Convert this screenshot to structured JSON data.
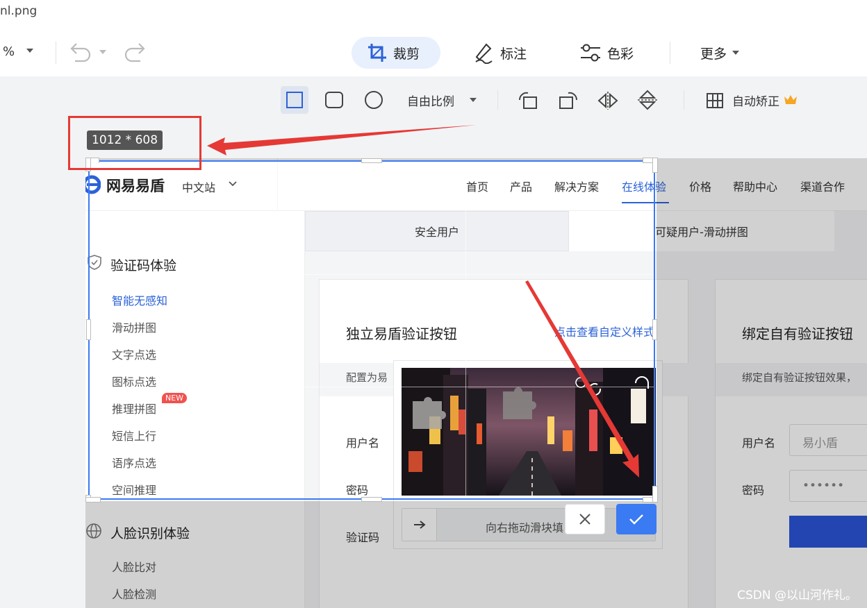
{
  "window": {
    "filename": "nl.png"
  },
  "toolbar": {
    "zoom_suffix": "%",
    "crop_label": "裁剪",
    "annotate_label": "标注",
    "color_label": "色彩",
    "more_label": "更多"
  },
  "subtoolbar": {
    "ratio_label": "自由比例",
    "auto_correct_label": "自动矫正"
  },
  "crop": {
    "size_label": "1012 * 608",
    "accent_color": "#3a7af2"
  },
  "site": {
    "brand": "网易易盾",
    "lang": "中文站",
    "nav": [
      "首页",
      "产品",
      "解决方案",
      "在线体验",
      "价格",
      "帮助中心",
      "渠道合作"
    ],
    "nav_active_index": 3
  },
  "sidebar": {
    "captcha_header": "验证码体验",
    "captcha_items": [
      "智能无感知",
      "滑动拼图",
      "文字点选",
      "图标点选",
      "推理拼图",
      "短信上行",
      "语序点选",
      "空间推理"
    ],
    "new_badge": "NEW",
    "face_header": "人脸识别体验",
    "face_items": [
      "人脸比对",
      "人脸检测"
    ]
  },
  "main": {
    "tabs": [
      "安全用户",
      "可疑用户-滑动拼图"
    ],
    "card1": {
      "title": "独立易盾验证按钮",
      "link": "点击查看自定义样式",
      "desc": "配置为易",
      "username_label": "用户名",
      "password_label": "密码",
      "captcha_label": "验证码",
      "slider_hint": "向右拖动滑块填"
    },
    "card2": {
      "title": "绑定自有验证按钮",
      "desc": "绑定自有验证按钮效果，",
      "username_label": "用户名",
      "username_value": "易小盾",
      "password_label": "密码",
      "password_value": "••••••"
    }
  },
  "watermark": "CSDN @以山河作礼。"
}
